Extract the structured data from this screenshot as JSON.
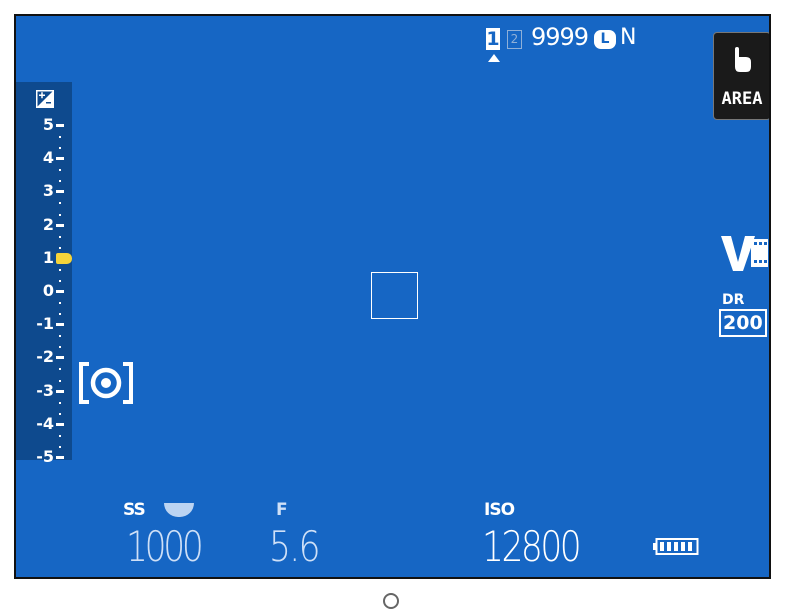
{
  "status": {
    "card_slot_1": "1",
    "card_slot_2": "2",
    "shots_remaining": "9999",
    "image_size": "L",
    "image_quality": "N"
  },
  "touch_button": {
    "label": "AREA",
    "icon": "touch-hand-icon"
  },
  "exposure_compensation": {
    "icon": "exposure-compensation-icon",
    "scale_labels": [
      "5",
      "4",
      "3",
      "2",
      "1",
      "0",
      "-1",
      "-2",
      "-3",
      "-4",
      "-5"
    ],
    "current_value": 1
  },
  "metering_icon": "multi-metering-icon",
  "film_simulation_icon": "film-simulation-velvia-icon",
  "dynamic_range": {
    "label": "DR",
    "value": "200"
  },
  "shutter_speed": {
    "label": "SS",
    "value": "1000"
  },
  "aperture": {
    "label": "F",
    "value": "5.6"
  },
  "iso": {
    "label": "ISO",
    "value": "12800"
  },
  "battery_icon": "battery-full-icon",
  "colors": {
    "screen_background": "#1666c4",
    "scale_background": "#0e4a8e",
    "ev_marker": "#f5d43a",
    "text": "#ffffff"
  }
}
